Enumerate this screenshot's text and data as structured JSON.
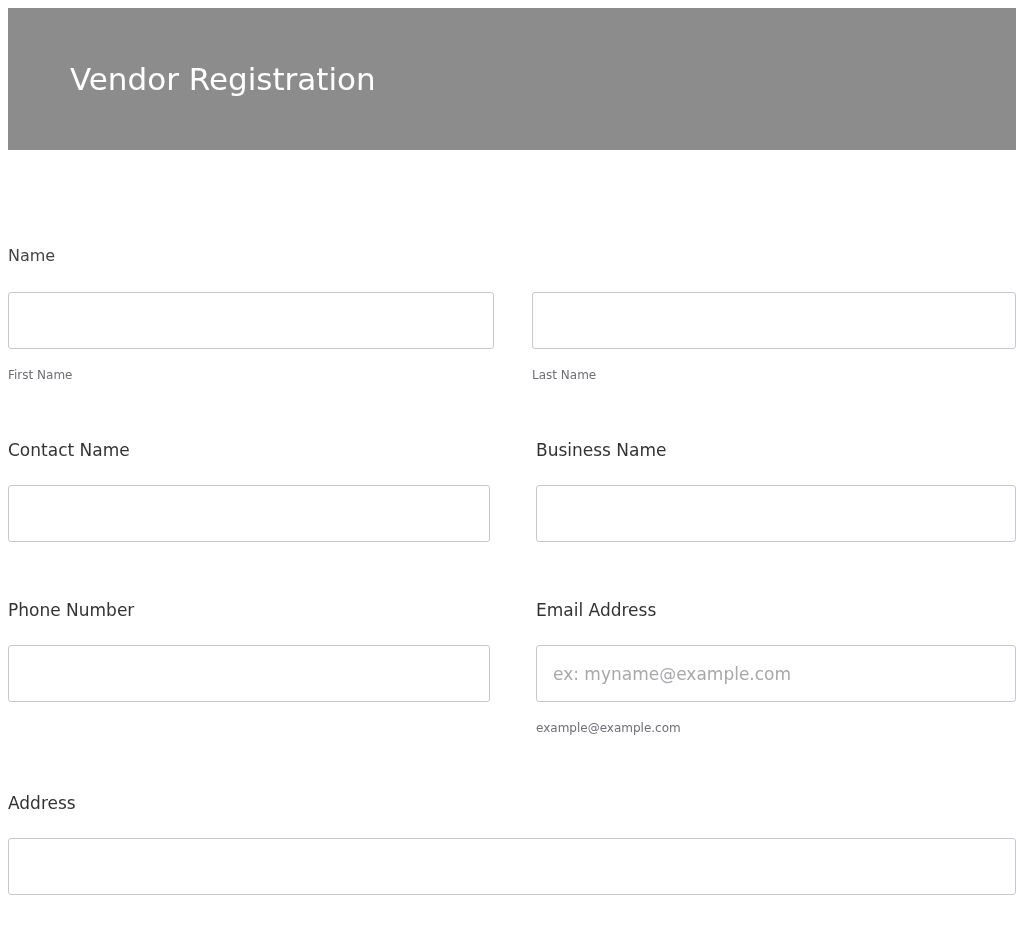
{
  "header": {
    "title": "Vendor Registration"
  },
  "rows": [
    {
      "kind": "split",
      "label": "Name",
      "fields": [
        {
          "sublabel": "First Name"
        },
        {
          "sublabel": "Last Name"
        }
      ]
    },
    {
      "kind": "pair",
      "fields": [
        {
          "label": "Contact Name"
        },
        {
          "label": "Business Name"
        }
      ]
    },
    {
      "kind": "pair",
      "fields": [
        {
          "label": "Phone Number"
        },
        {
          "label": "Email Address",
          "placeholder": "ex: myname@example.com",
          "sublabel": "example@example.com"
        }
      ]
    },
    {
      "kind": "full",
      "fields": [
        {
          "label": "Address"
        }
      ]
    }
  ]
}
